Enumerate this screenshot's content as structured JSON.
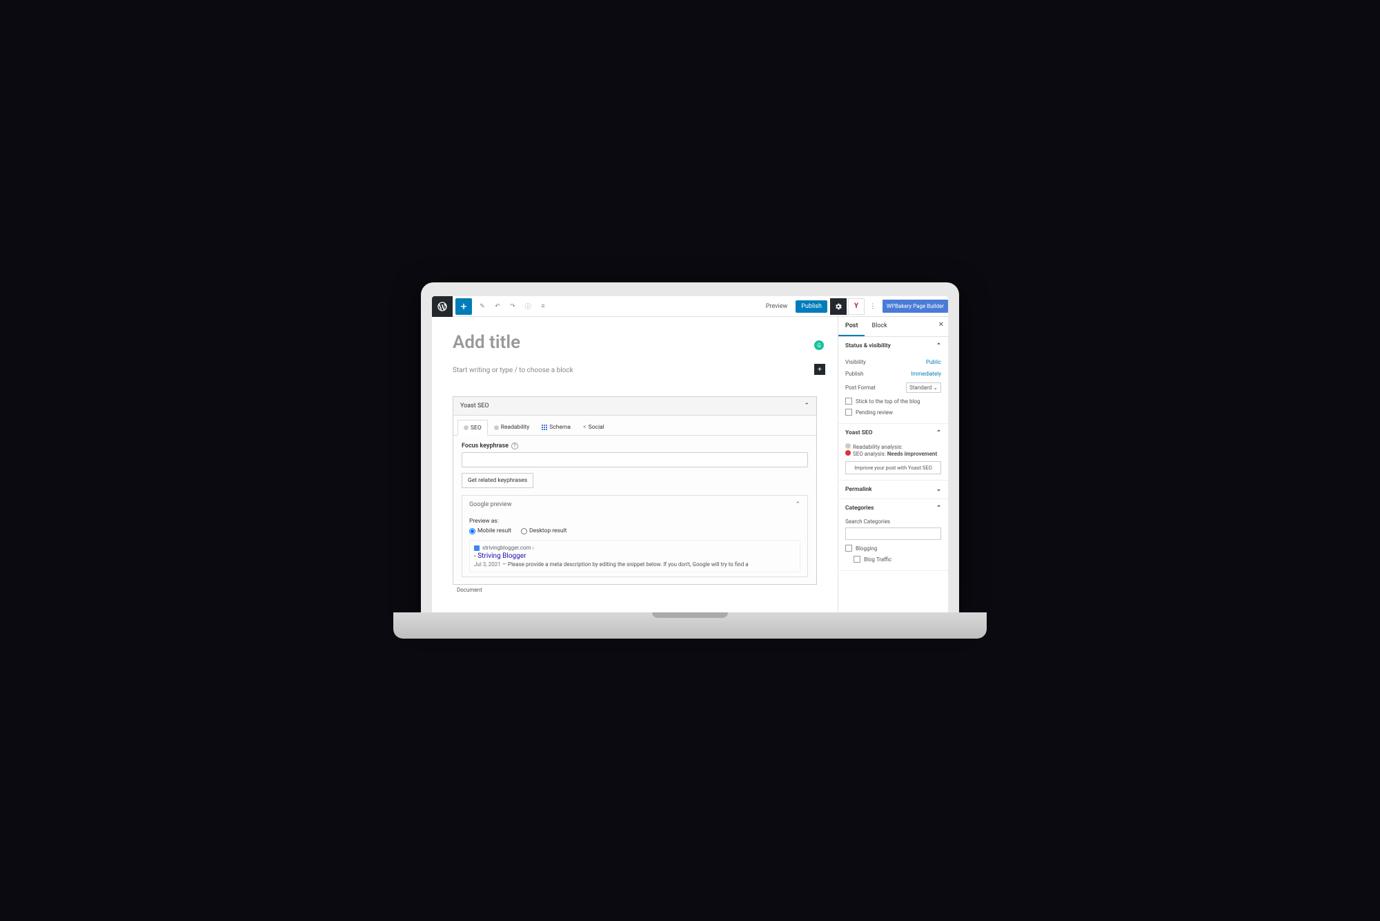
{
  "toolbar": {
    "preview": "Preview",
    "publish": "Publish",
    "wpbakery": "WPBakery Page Builder"
  },
  "editor": {
    "title_placeholder": "Add title",
    "content_placeholder": "Start writing or type / to choose a block"
  },
  "yoast": {
    "panel_title": "Yoast SEO",
    "tabs": {
      "seo": "SEO",
      "readability": "Readability",
      "schema": "Schema",
      "social": "Social"
    },
    "focus_label": "Focus keyphrase",
    "related_btn": "Get related keyphrases",
    "google_preview": "Google preview",
    "preview_as": "Preview as:",
    "mobile": "Mobile result",
    "desktop": "Desktop result",
    "snippet_url": "strivingblogger.com ›",
    "snippet_title": "- Striving Blogger",
    "snippet_date": "Jul 3, 2021",
    "snippet_desc": "Please provide a meta description by editing the snippet below. If you don't, Google will try to find a"
  },
  "footer": {
    "document": "Document"
  },
  "sidebar": {
    "tabs": {
      "post": "Post",
      "block": "Block"
    },
    "status": {
      "title": "Status & visibility",
      "visibility_label": "Visibility",
      "visibility_value": "Public",
      "publish_label": "Publish",
      "publish_value": "Immediately",
      "format_label": "Post Format",
      "format_value": "Standard",
      "stick": "Stick to the top of the blog",
      "pending": "Pending review"
    },
    "yoast_section": {
      "title": "Yoast SEO",
      "readability": "Readability analysis:",
      "seo_analysis": "SEO analysis:",
      "seo_status": "Needs improvement",
      "improve": "Improve your post with Yoast SEO"
    },
    "permalink": "Permalink",
    "categories": {
      "title": "Categories",
      "search": "Search Categories",
      "blogging": "Blogging",
      "blog_traffic": "Blog Traffic"
    }
  }
}
